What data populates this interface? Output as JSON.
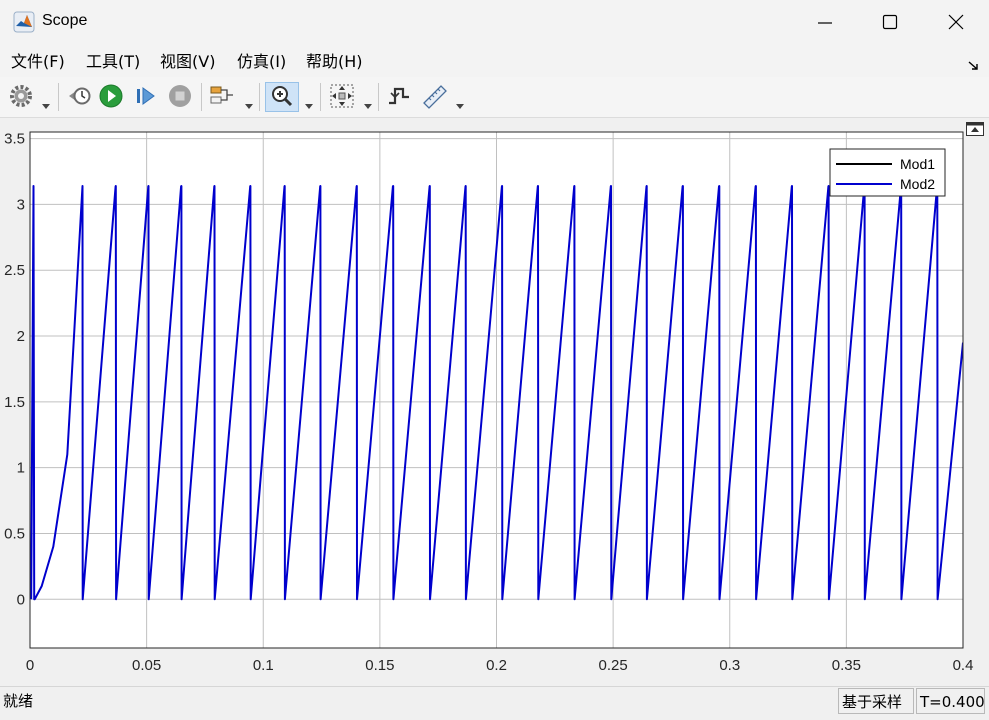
{
  "window": {
    "title": "Scope",
    "icon": "matlab-icon",
    "controls": [
      "minimize-icon",
      "maximize-icon",
      "close-icon"
    ]
  },
  "menu": {
    "file": "文件(F)",
    "tools": "工具(T)",
    "view": "视图(V)",
    "simulation": "仿真(I)",
    "help": "帮助(H)"
  },
  "toolbar": {
    "buttons": [
      "settings-gear-icon",
      "step-back-icon",
      "run-icon",
      "step-forward-icon",
      "stop-icon",
      "signal-selector-icon",
      "zoom-in-icon",
      "autoscale-icon",
      "triggers-icon",
      "measurements-icon"
    ],
    "active": "zoom-in-icon",
    "colors": {
      "run": "#2a9d3c",
      "stop": "#a0a0a0",
      "zoom_active": "#cfe3f7"
    }
  },
  "status": {
    "left": "就绪",
    "mode": "基于采样",
    "time": "T=0.400"
  },
  "chart_data": {
    "type": "line",
    "xlim": [
      0,
      0.4
    ],
    "ylim": [
      -0.37,
      3.55
    ],
    "x_ticks": [
      "0",
      "0.05",
      "0.1",
      "0.15",
      "0.2",
      "0.25",
      "0.3",
      "0.35",
      "0.4"
    ],
    "y_ticks": [
      "0",
      "0.5",
      "1",
      "1.5",
      "2",
      "2.5",
      "3",
      "3.5"
    ],
    "grid": true,
    "legend_position": "top-right",
    "background": "#ffffff",
    "series": [
      {
        "name": "Mod1",
        "color": "#000000",
        "peak": 3.14,
        "wrap_times": [],
        "end_value": null
      },
      {
        "name": "Mod2",
        "color": "#0000cd",
        "peak": 3.14,
        "initial_spike": {
          "at": 0.0015,
          "value": 3.14
        },
        "start_curve": [
          [
            0.002,
            0.0
          ],
          [
            0.005,
            0.1
          ],
          [
            0.01,
            0.4
          ],
          [
            0.016,
            1.1
          ],
          [
            0.0225,
            3.14
          ]
        ],
        "wrap_times": [
          0.0225,
          0.0368,
          0.0508,
          0.0649,
          0.0791,
          0.0945,
          0.1092,
          0.1245,
          0.1401,
          0.1557,
          0.1714,
          0.1868,
          0.2024,
          0.2178,
          0.2334,
          0.2491,
          0.2644,
          0.2799,
          0.2955,
          0.3112,
          0.3267,
          0.3424,
          0.3578,
          0.3735,
          0.389
        ],
        "end_value": 1.95
      }
    ]
  }
}
